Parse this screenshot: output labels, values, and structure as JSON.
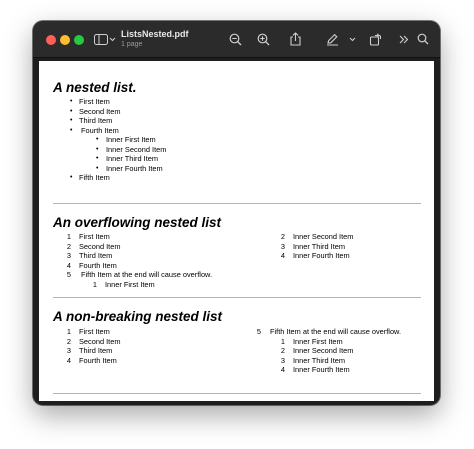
{
  "window": {
    "title": "ListsNested.pdf",
    "subtitle": "1 page"
  },
  "toolbar": {
    "icons": [
      "sidebar-icon",
      "chevron-down-icon",
      "zoom-out-icon",
      "zoom-in-icon",
      "share-icon",
      "markup-pen-icon",
      "chevron-down-icon",
      "rotate-icon",
      "more-chevrons-icon",
      "search-icon"
    ]
  },
  "document": {
    "sections": [
      {
        "heading": "A nested list.",
        "bullet": "•",
        "items": [
          "First Item",
          "Second Item",
          "Third Item",
          "Fourth Item"
        ],
        "inner_items": [
          "Inner First Item",
          "Inner Second Item",
          "Inner Third Item",
          "Inner Fourth Item"
        ],
        "after_item": "Fifth Item"
      },
      {
        "heading": "An overflowing nested list",
        "numbers": [
          "1",
          "2",
          "3",
          "4",
          "5"
        ],
        "items": [
          "First Item",
          "Second Item",
          "Third Item",
          "Fourth Item",
          "Fifth Item at the end will cause overflow."
        ],
        "inner_numbers": [
          "1",
          "2",
          "3",
          "4"
        ],
        "inner_items": [
          "Inner First Item",
          "Inner Second Item",
          "Inner Third Item",
          "Inner Fourth Item"
        ]
      },
      {
        "heading": "A non-breaking nested list",
        "numbers": [
          "1",
          "2",
          "3",
          "4",
          "5"
        ],
        "items": [
          "First Item",
          "Second Item",
          "Third Item",
          "Fourth Item",
          "Fifth Item at the end will cause overflow."
        ],
        "inner_numbers": [
          "1",
          "2",
          "3",
          "4"
        ],
        "inner_items": [
          "Inner First Item",
          "Inner Second Item",
          "Inner Third Item",
          "Inner Fourth Item"
        ]
      }
    ]
  }
}
